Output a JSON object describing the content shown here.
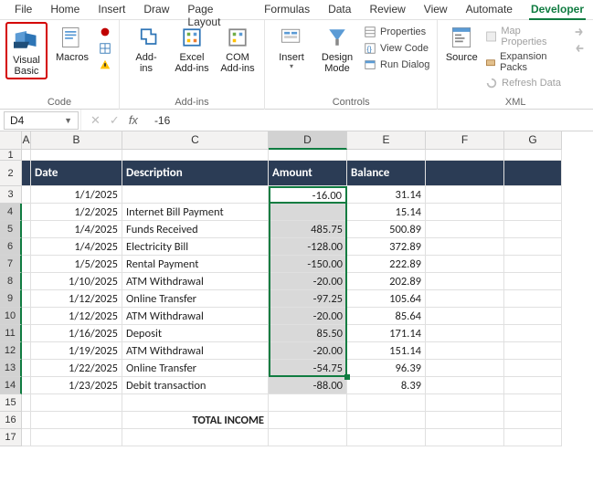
{
  "tabs": [
    "File",
    "Home",
    "Insert",
    "Draw",
    "Page Layout",
    "Formulas",
    "Data",
    "Review",
    "View",
    "Automate",
    "Developer"
  ],
  "activeTab": 10,
  "ribbon": {
    "code": {
      "label": "Code",
      "vb": "Visual\nBasic",
      "macros": "Macros"
    },
    "addins": {
      "label": "Add-ins",
      "addins": "Add-\nins",
      "excel": "Excel\nAdd-ins",
      "com": "COM\nAdd-ins"
    },
    "controls": {
      "label": "Controls",
      "insert": "Insert",
      "design": "Design\nMode",
      "prop": "Properties",
      "view": "View Code",
      "run": "Run Dialog"
    },
    "xml": {
      "label": "XML",
      "source": "Source",
      "map": "Map Properties",
      "exp": "Expansion Packs",
      "ref": "Refresh Data"
    }
  },
  "namebox": "D4",
  "formula": "-16",
  "cols": [
    "A",
    "B",
    "C",
    "D",
    "E",
    "F",
    "G"
  ],
  "headers": {
    "date": "Date",
    "desc": "Description",
    "amount": "Amount",
    "balance": "Balance"
  },
  "rows": [
    {
      "n": 3,
      "date": "1/1/2025",
      "desc": "",
      "amount": "",
      "balance": "31.14"
    },
    {
      "n": 4,
      "date": "1/2/2025",
      "desc": "Internet Bill Payment",
      "amount": "-16.00",
      "balance": "15.14"
    },
    {
      "n": 5,
      "date": "1/4/2025",
      "desc": "Funds Received",
      "amount": "485.75",
      "balance": "500.89"
    },
    {
      "n": 6,
      "date": "1/4/2025",
      "desc": "Electricity Bill",
      "amount": "-128.00",
      "balance": "372.89"
    },
    {
      "n": 7,
      "date": "1/5/2025",
      "desc": "Rental Payment",
      "amount": "-150.00",
      "balance": "222.89"
    },
    {
      "n": 8,
      "date": "1/10/2025",
      "desc": "ATM Withdrawal",
      "amount": "-20.00",
      "balance": "202.89"
    },
    {
      "n": 9,
      "date": "1/12/2025",
      "desc": "Online Transfer",
      "amount": "-97.25",
      "balance": "105.64"
    },
    {
      "n": 10,
      "date": "1/12/2025",
      "desc": "ATM Withdrawal",
      "amount": "-20.00",
      "balance": "85.64"
    },
    {
      "n": 11,
      "date": "1/16/2025",
      "desc": "Deposit",
      "amount": "85.50",
      "balance": "171.14"
    },
    {
      "n": 12,
      "date": "1/19/2025",
      "desc": "ATM Withdrawal",
      "amount": "-20.00",
      "balance": "151.14"
    },
    {
      "n": 13,
      "date": "1/22/2025",
      "desc": "Online Transfer",
      "amount": "-54.75",
      "balance": "96.39"
    },
    {
      "n": 14,
      "date": "1/23/2025",
      "desc": "Debit transaction",
      "amount": "-88.00",
      "balance": "8.39"
    }
  ],
  "totalLabel": "TOTAL INCOME",
  "selection": {
    "active": "D4",
    "range": "D4:D14"
  }
}
